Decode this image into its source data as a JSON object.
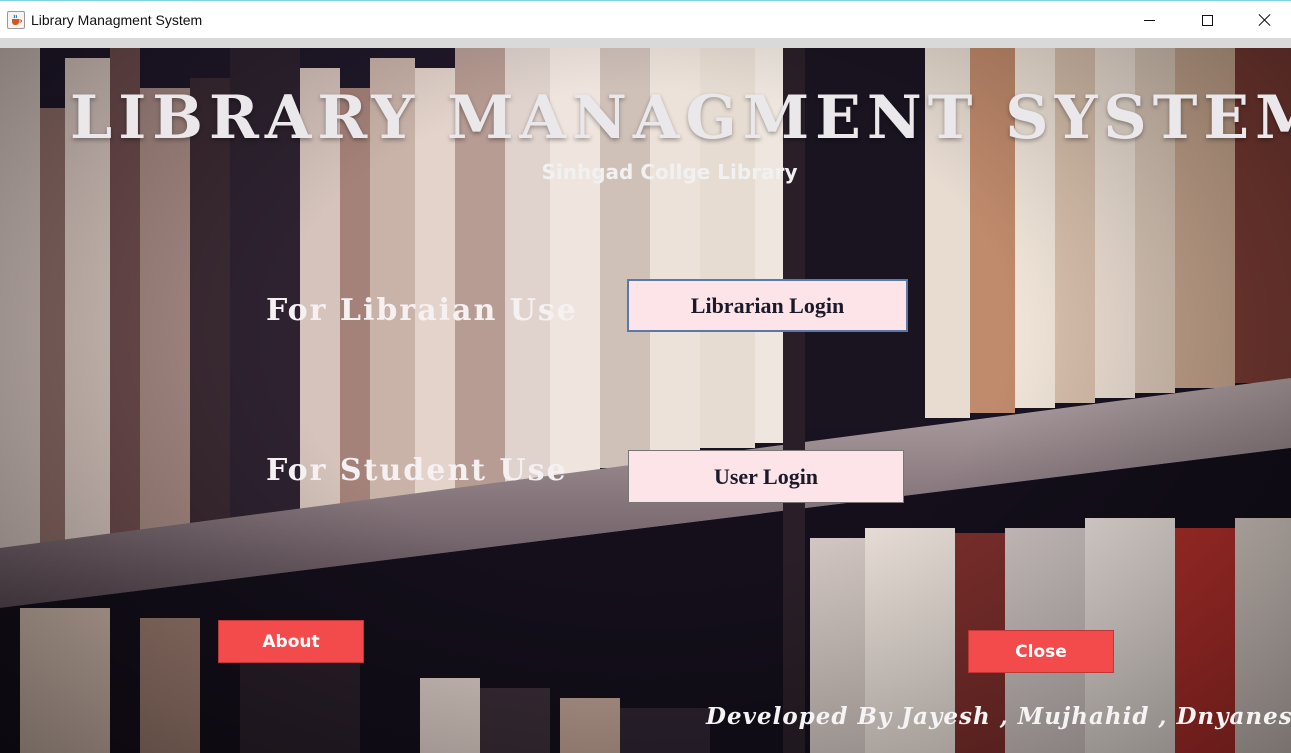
{
  "window": {
    "title": "Library Managment System",
    "icons": {
      "app": "java-cup-icon",
      "minimize": "minimize-icon",
      "maximize": "maximize-icon",
      "close": "close-icon"
    }
  },
  "main": {
    "title": "LIBRARY MANAGMENT SYSTEM",
    "subtitle": "Sinhgad Collge Library",
    "librarian_label": "For Libraian Use",
    "student_label": "For Student Use",
    "librarian_button": "Librarian Login",
    "user_button": "User Login",
    "about_button": "About",
    "close_button": "Close",
    "credits": "Developed By Jayesh , Mujhahid , Dnyanesh"
  },
  "colors": {
    "login_button_bg": "#fde4e8",
    "red_button_bg": "#f34a4b",
    "title_text": "#ebe8eb"
  }
}
